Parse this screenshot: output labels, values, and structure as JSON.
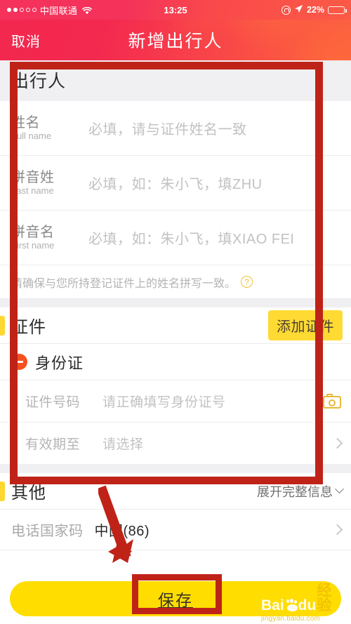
{
  "status_bar": {
    "signal_filled": 2,
    "signal_total": 5,
    "carrier": "中国联通",
    "wifi_icon": "wifi-icon",
    "time": "13:25",
    "rotation_lock_icon": "rotation-lock-icon",
    "location_icon": "location-arrow-icon",
    "battery_percent": "22%",
    "battery_level": 22
  },
  "navbar": {
    "cancel_label": "取消",
    "title": "新增出行人"
  },
  "traveler_section": {
    "heading": "出行人",
    "fields": [
      {
        "label_cn": "姓名",
        "label_en": "Full name",
        "placeholder": "必填，请与证件姓名一致",
        "value": ""
      },
      {
        "label_cn": "拼音姓",
        "label_en": "Last name",
        "placeholder": "必填，如：朱小飞，填ZHU",
        "value": ""
      },
      {
        "label_cn": "拼音名",
        "label_en": "First name",
        "placeholder": "必填，如：朱小飞，填XIAO FEI",
        "value": ""
      }
    ],
    "hint": "请确保与您所持登记证件上的姓名拼写一致。",
    "hint_icon": "question-mark-icon"
  },
  "credential_section": {
    "heading": "证件",
    "add_button": "添加证件",
    "id_type": "身份证",
    "remove_icon": "minus-circle-icon",
    "rows": [
      {
        "label": "证件号码",
        "placeholder": "请正确填写身份证号",
        "value": "",
        "trailing_icon": "camera-icon"
      },
      {
        "label": "有效期至",
        "placeholder": "请选择",
        "value": "",
        "trailing_icon": "chevron-right-icon"
      }
    ]
  },
  "other_section": {
    "heading": "其他",
    "expand_label": "展开完整信息",
    "expand_icon": "chevron-down-icon",
    "rows": [
      {
        "label": "电话国家码",
        "value": "中国(86)",
        "trailing_icon": "chevron-right-icon"
      }
    ]
  },
  "save_bar": {
    "save_label": "保存"
  },
  "watermark": {
    "brand": "Bai",
    "brand2": "du",
    "suffix": "经验",
    "url": "jingyan.baidu.com",
    "paw_icon": "paw-icon"
  },
  "annotations": {
    "box_form_name": "annotation-box-form",
    "box_save_name": "annotation-box-save",
    "arrow_name": "annotation-arrow",
    "color": "#bf2318"
  },
  "colors": {
    "header_red": "#f3284f",
    "accent_yellow": "#ffdd00",
    "button_yellow": "#ffda33",
    "orange": "#f4511e",
    "annotation_red": "#bf2318"
  }
}
